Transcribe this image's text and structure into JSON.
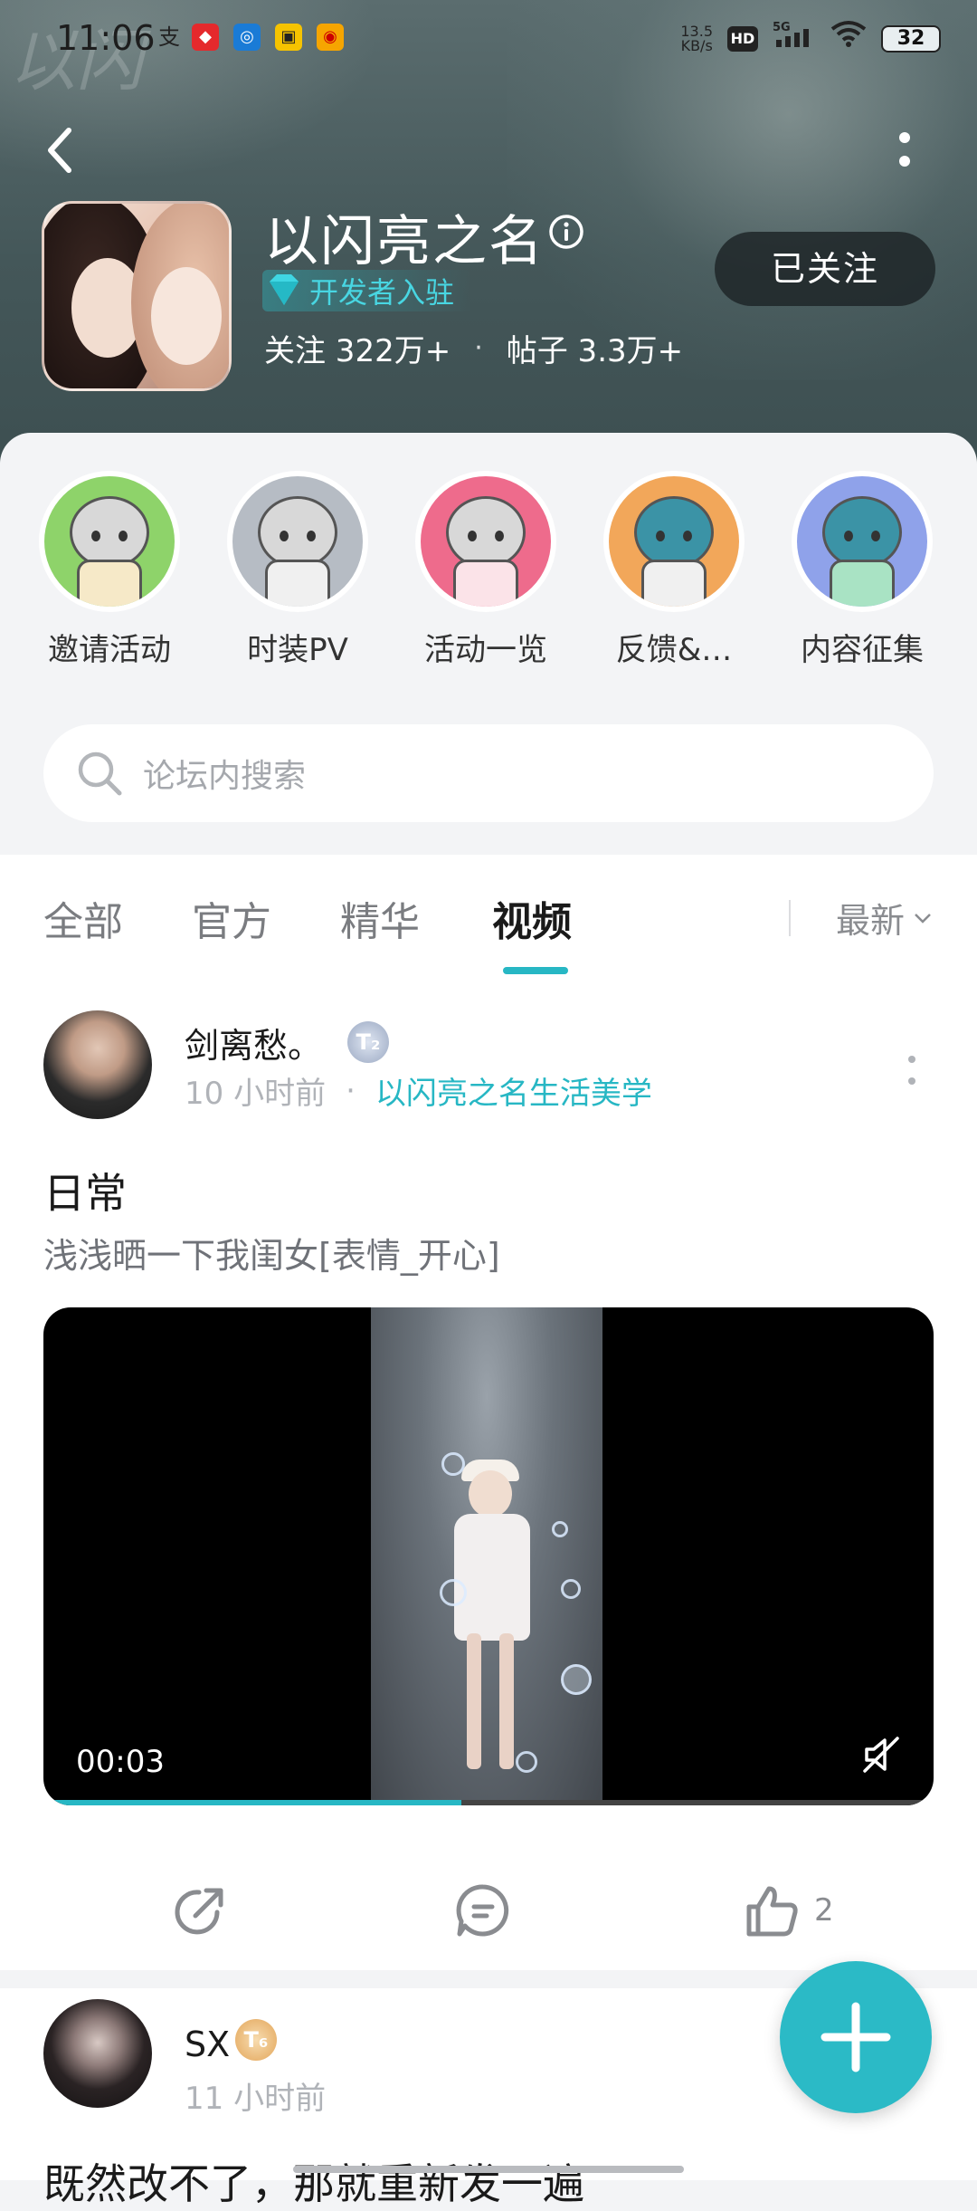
{
  "status_bar": {
    "time": "11:06",
    "net_speed": "13.5\nKB/s",
    "battery": "32",
    "network": "5G"
  },
  "forum": {
    "title": "以闪亮之名",
    "developer_badge": "开发者入驻",
    "followers": "关注 322万+",
    "posts": "帖子 3.3万+",
    "stats_sep": "·",
    "follow_button": "已关注"
  },
  "shortcuts": [
    {
      "label": "邀请活动",
      "color": "#8ed36a"
    },
    {
      "label": "时装PV",
      "color": "#b6bcc4"
    },
    {
      "label": "活动一览",
      "color": "#ee6b8c"
    },
    {
      "label": "反馈&…",
      "color": "#f2a75a"
    },
    {
      "label": "内容征集",
      "color": "#8fa2ea"
    }
  ],
  "search": {
    "placeholder": "论坛内搜索"
  },
  "tabs": [
    "全部",
    "官方",
    "精华",
    "视频"
  ],
  "active_tab": "视频",
  "sort_label": "最新",
  "posts": [
    {
      "author": "剑离愁。",
      "level": "T₂",
      "time": "10 小时前",
      "forum": "以闪亮之名生活美学",
      "title": "日常",
      "body": "浅浅晒一下我闺女[表情_开心]",
      "video_time": "00:03",
      "video_progress": 0.47,
      "likes": "2"
    },
    {
      "author": "SX",
      "level": "T₆",
      "time": "11 小时前",
      "title": "既然改不了，那就重新发一遍"
    }
  ],
  "colors": {
    "accent": "#27b7c4",
    "header": "#4a5c5e"
  }
}
